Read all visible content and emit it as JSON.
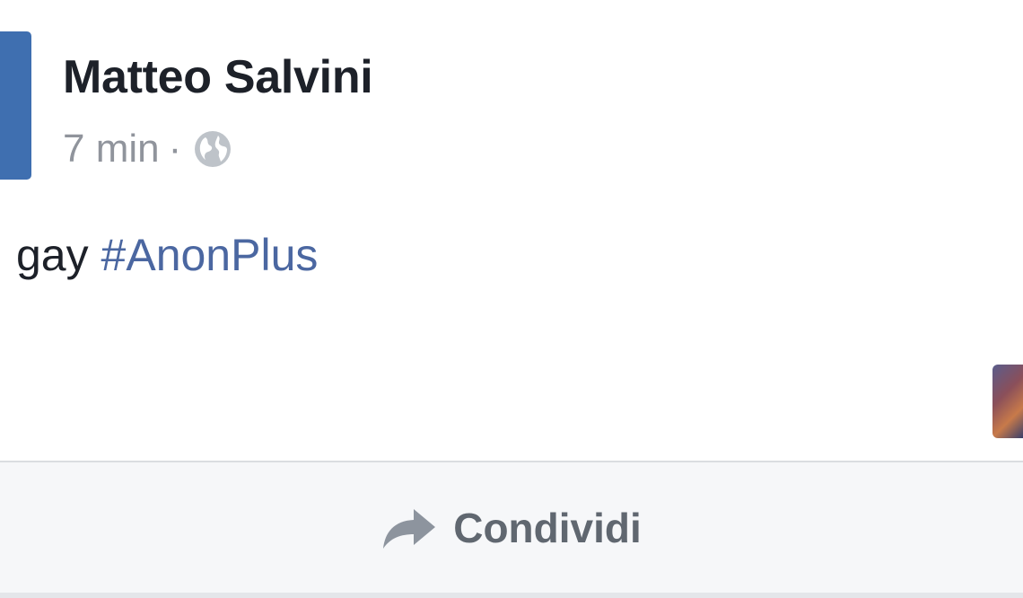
{
  "post": {
    "author": "Matteo Salvini",
    "timestamp": "7 min",
    "separator": "·",
    "privacy_icon": "globe-icon",
    "text": "gay",
    "hashtag": "#AnonPlus"
  },
  "actions": {
    "share_label": "Condividi",
    "share_icon": "share-arrow-icon"
  },
  "colors": {
    "author": "#1d2129",
    "meta": "#90949c",
    "hashtag": "#4b67a1",
    "avatar": "#3f6fb0",
    "share_bar_bg": "#f6f7f9",
    "share_label": "#606770"
  }
}
